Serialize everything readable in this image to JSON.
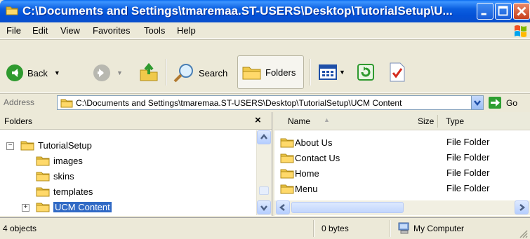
{
  "window": {
    "title": "C:\\Documents and Settings\\tmaremaa.ST-USERS\\Desktop\\TutorialSetup\\U..."
  },
  "menu": [
    "File",
    "Edit",
    "View",
    "Favorites",
    "Tools",
    "Help"
  ],
  "toolbar": {
    "back_label": "Back",
    "search_label": "Search",
    "folders_label": "Folders"
  },
  "address": {
    "label": "Address",
    "value": "C:\\Documents and Settings\\tmaremaa.ST-USERS\\Desktop\\TutorialSetup\\UCM Content",
    "go_label": "Go"
  },
  "folders_pane": {
    "title": "Folders",
    "close_glyph": "×",
    "tree": [
      {
        "label": "TutorialSetup",
        "expander": "−"
      },
      {
        "label": "images"
      },
      {
        "label": "skins"
      },
      {
        "label": "templates"
      },
      {
        "label": "UCM Content",
        "expander": "+"
      }
    ]
  },
  "files_pane": {
    "columns": {
      "name": "Name",
      "size": "Size",
      "type": "Type"
    },
    "rows": [
      {
        "name": "About Us",
        "type": "File Folder"
      },
      {
        "name": "Contact Us",
        "type": "File Folder"
      },
      {
        "name": "Home",
        "type": "File Folder"
      },
      {
        "name": "Menu",
        "type": "File Folder"
      }
    ]
  },
  "status": {
    "objects": "4 objects",
    "size": "0 bytes",
    "location": "My Computer"
  },
  "colors": {
    "title_blue": "#0451d6",
    "selection": "#316ac5",
    "chrome": "#ece9d8"
  }
}
